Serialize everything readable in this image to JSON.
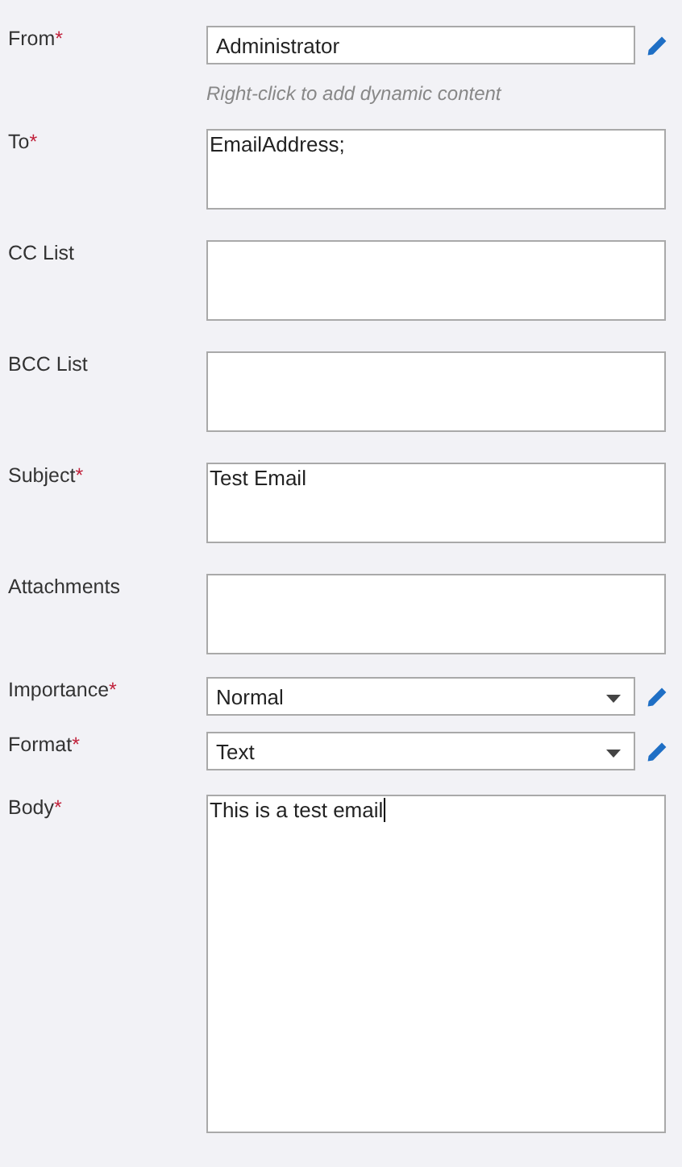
{
  "fields": [
    {
      "kind": "input",
      "label": "From",
      "required_mark": "*",
      "value": "Administrator",
      "has_edit": true,
      "hint": "Right-click to add dynamic content"
    },
    {
      "kind": "textarea",
      "label": "To",
      "required_mark": "*",
      "value": "EmailAddress;"
    },
    {
      "kind": "textarea",
      "label": "CC List"
    },
    {
      "kind": "textarea",
      "label": "BCC List"
    },
    {
      "kind": "textarea",
      "label": "Subject",
      "required_mark": "*",
      "value": "Test Email"
    },
    {
      "kind": "textarea",
      "label": "Attachments"
    },
    {
      "kind": "select",
      "label": "Importance",
      "required_mark": "*",
      "value": "Normal",
      "has_edit": true
    },
    {
      "kind": "select",
      "label": "Format",
      "required_mark": "*",
      "value": "Text",
      "has_edit": true
    },
    {
      "kind": "body",
      "label": "Body",
      "required_mark": "*",
      "value": "This is a test email",
      "focused": true
    }
  ]
}
